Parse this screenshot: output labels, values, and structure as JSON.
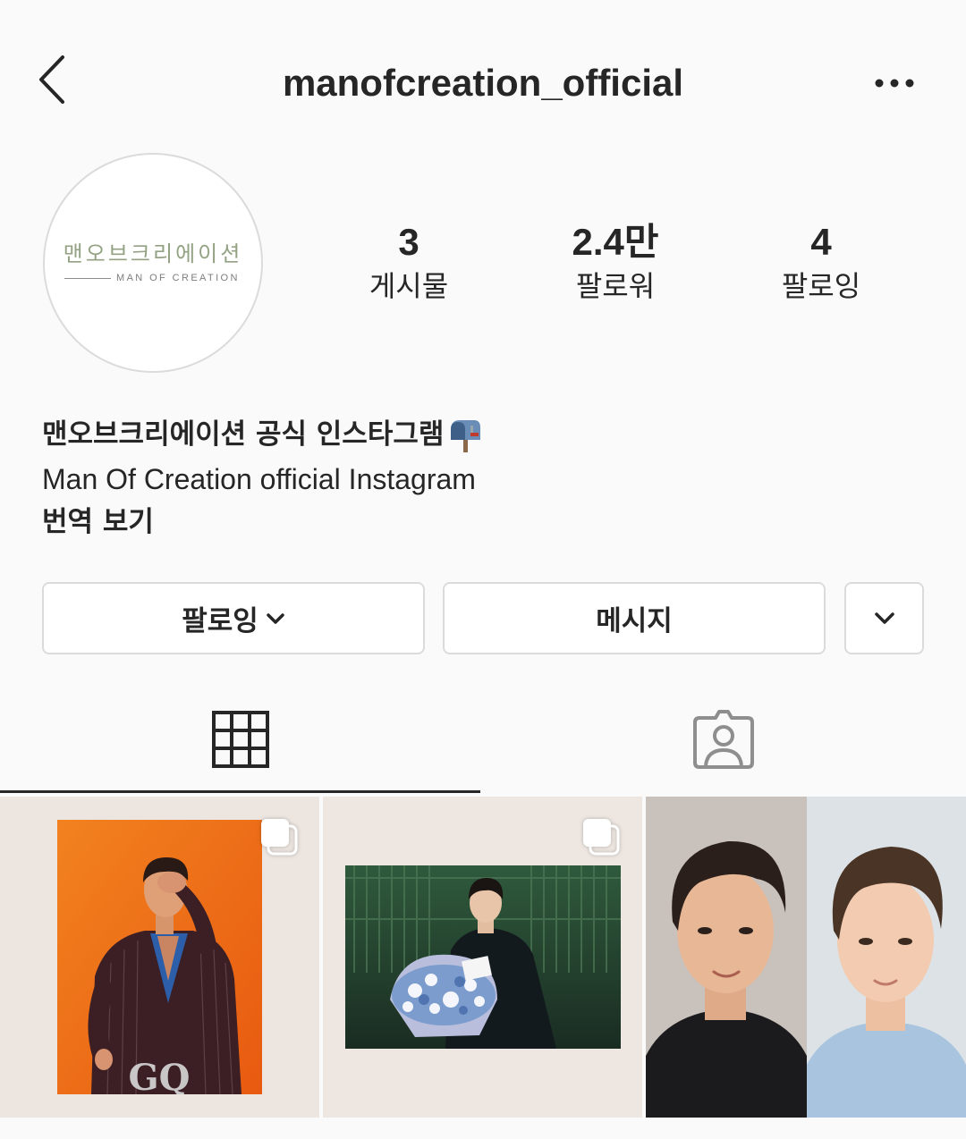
{
  "header": {
    "username": "manofcreation_official",
    "back_icon": "chevron-left-icon",
    "more_icon": "more-horizontal-icon"
  },
  "profile": {
    "avatar_logo_korean": "맨오브크리에이션",
    "avatar_logo_english": "MAN OF CREATION"
  },
  "stats": [
    {
      "value": "3",
      "label": "게시물"
    },
    {
      "value": "2.4만",
      "label": "팔로워"
    },
    {
      "value": "4",
      "label": "팔로잉"
    }
  ],
  "bio": {
    "name": "맨오브크리에이션 공식 인스타그램",
    "name_icon": "mailbox-icon",
    "description": "Man Of Creation official Instagram",
    "translate_link": "번역 보기"
  },
  "actions": {
    "following_label": "팔로잉",
    "following_icon": "chevron-down-icon",
    "message_label": "메시지",
    "suggestions_icon": "chevron-down-icon"
  },
  "tabs": [
    {
      "icon": "grid-icon",
      "active": true
    },
    {
      "icon": "tagged-person-icon",
      "active": false
    }
  ],
  "posts": [
    {
      "type": "carousel",
      "badge_icon": "multiple-images-icon",
      "overlay_text": "GQ"
    },
    {
      "type": "carousel",
      "badge_icon": "multiple-images-icon"
    },
    {
      "type": "image"
    }
  ],
  "colors": {
    "background": "#fafafa",
    "text": "#262626",
    "border": "#dbdbdb",
    "icon_muted": "#8e8e8e",
    "logo_green": "#93a283"
  }
}
